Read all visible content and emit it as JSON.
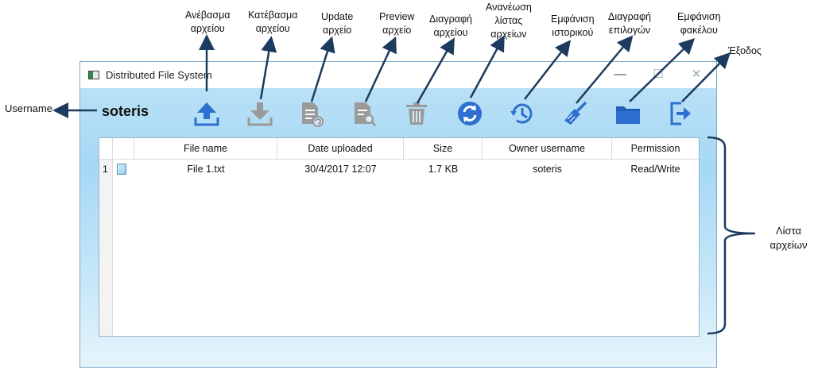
{
  "annotations": {
    "upload": [
      "Ανέβασμα",
      "αρχείου"
    ],
    "download": [
      "Κατέβασμα",
      "αρχείου"
    ],
    "update": [
      "Update",
      "αρχείο"
    ],
    "preview": [
      "Preview",
      "αρχείο"
    ],
    "delete": [
      "Διαγραφή",
      "αρχείου"
    ],
    "refresh": [
      "Ανανέωση",
      "λίστας",
      "αρχείων"
    ],
    "history": [
      "Εμφάνιση",
      "ιστορικού"
    ],
    "clear": [
      "Διαγραφή",
      "επιλογών"
    ],
    "folder": [
      "Εμφάνιση",
      "φακέλου"
    ],
    "exit": [
      "Έξοδος"
    ],
    "username": "Username",
    "file_list": [
      "Λίστα",
      "αρχείων"
    ]
  },
  "window": {
    "title": "Distributed File System",
    "minimize": "—",
    "maximize": "☐",
    "close": "✕"
  },
  "username": "soteris",
  "toolbar": {
    "upload_icon": "upload-icon",
    "download_icon": "download-icon",
    "update_icon": "update-file-icon",
    "preview_icon": "preview-file-icon",
    "delete_icon": "trash-icon",
    "refresh_icon": "refresh-icon",
    "history_icon": "history-icon",
    "clear_icon": "broom-icon",
    "folder_icon": "folder-icon",
    "exit_icon": "exit-icon",
    "accent_blue": "#2f6fd0",
    "disabled_gray": "#9a9a9a"
  },
  "table": {
    "columns": [
      "File name",
      "Date uploaded",
      "Size",
      "Owner username",
      "Permission"
    ],
    "rows": [
      {
        "num": "1",
        "file_name": "File 1.txt",
        "date_uploaded": "30/4/2017 12:07",
        "size": "1.7 KB",
        "owner": "soteris",
        "permission": "Read/Write"
      }
    ]
  }
}
